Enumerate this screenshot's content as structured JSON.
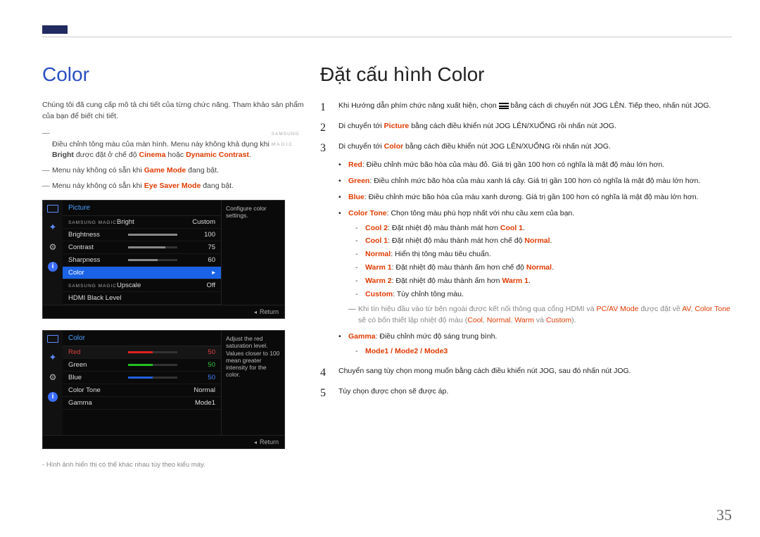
{
  "page_number": "35",
  "left": {
    "title": "Color",
    "intro": "Chúng tôi đã cung cấp mô tả chi tiết của từng chức năng. Tham khảo sản phẩm của bạn để biết chi tiết.",
    "bullets": [
      {
        "pre": "Điều chỉnh tông màu của màn hình. Menu này không khả dụng khi ",
        "magic_prefix": "SAMSUNG",
        "magic_word": "MAGIC",
        "magic_suffix": "Bright",
        "mid": " được đặt ở chế độ ",
        "kw1": "Cinema",
        "or": " hoặc ",
        "kw2": "Dynamic Contrast",
        "post": "."
      },
      {
        "pre": "Menu này không có sẵn khi ",
        "kw1": "Game Mode",
        "post": " đang bật."
      },
      {
        "pre": "Menu này không có sẵn khi ",
        "kw1": "Eye Saver Mode",
        "post": " đang bật."
      }
    ],
    "osd1": {
      "title": "Picture",
      "hint": "Configure color settings.",
      "rows": [
        {
          "label_prefix": "SAMSUNG MAGIC",
          "label": "Bright",
          "value": "Custom"
        },
        {
          "label": "Brightness",
          "bar": 100,
          "value": "100"
        },
        {
          "label": "Contrast",
          "bar": 75,
          "value": "75"
        },
        {
          "label": "Sharpness",
          "bar": 60,
          "value": "60"
        },
        {
          "label": "Color",
          "selected": true,
          "arrow": "▸"
        },
        {
          "label_prefix": "SAMSUNG MAGIC",
          "label": "Upscale",
          "value": "Off"
        },
        {
          "label": "HDMI Black Level"
        }
      ],
      "return": "Return"
    },
    "osd2": {
      "title": "Color",
      "hint": "Adjust the red saturation level. Values closer to 100 mean greater intensity for the color.",
      "rows": [
        {
          "label": "Red",
          "bar": 50,
          "barclass": "red",
          "value": "50",
          "valclass": "red-val",
          "selected": true
        },
        {
          "label": "Green",
          "bar": 50,
          "barclass": "green",
          "value": "50",
          "valclass": "green-val"
        },
        {
          "label": "Blue",
          "bar": 50,
          "barclass": "blue",
          "value": "50",
          "valclass": "blue-val"
        },
        {
          "label": "Color Tone",
          "value": "Normal"
        },
        {
          "label": "Gamma",
          "value": "Mode1"
        }
      ],
      "return": "Return"
    },
    "footnote": "Hình ảnh hiển thị có thể khác nhau tùy theo kiểu máy."
  },
  "right": {
    "title": "Đặt cấu hình Color",
    "step1": "Khi Hướng dẫn phím chức năng xuất hiện, chọn ",
    "step1b": " bằng cách di chuyển nút JOG LÊN. Tiếp theo, nhấn nút JOG.",
    "step2_pre": "Di chuyển tới ",
    "step2_kw": "Picture",
    "step2_post": " bằng cách điều khiển nút JOG LÊN/XUỐNG rồi nhấn nút JOG.",
    "step3_pre": "Di chuyển tới ",
    "step3_kw": "Color",
    "step3_post": " bằng cách điều khiển nút JOG LÊN/XUỐNG rồi nhấn nút JOG.",
    "colors": [
      {
        "kw": "Red",
        "text": ": Điều chỉnh mức bão hòa của màu đỏ. Giá trị gần 100 hơn có nghĩa là mật độ màu lớn hơn."
      },
      {
        "kw": "Green",
        "text": ": Điều chỉnh mức bão hòa của màu xanh lá cây. Giá trị gần 100 hơn có nghĩa là mật độ màu lớn hơn."
      },
      {
        "kw": "Blue",
        "text": ": Điều chỉnh mức bão hòa của màu xanh dương. Giá trị gần 100 hơn có nghĩa là mật độ màu lớn hơn."
      }
    ],
    "colortone_kw": "Color Tone",
    "colortone_text": ": Chọn tông màu phù hợp nhất với nhu cầu xem của bạn.",
    "tones": [
      {
        "kw": "Cool 2",
        "pre": ": Đặt nhiệt độ màu thành mát hơn ",
        "kw2": "Cool 1",
        "post": "."
      },
      {
        "kw": "Cool 1",
        "pre": ": Đặt nhiệt độ màu thành mát hơn chế độ ",
        "kw2": "Normal",
        "post": "."
      },
      {
        "kw": "Normal",
        "pre": ": Hiển thị tông màu tiêu chuẩn."
      },
      {
        "kw": "Warm 1",
        "pre": ": Đặt nhiệt độ màu thành ấm hơn chế độ ",
        "kw2": "Normal",
        "post": "."
      },
      {
        "kw": "Warm 2",
        "pre": ": Đặt nhiệt độ màu thành ấm hơn ",
        "kw2": "Warm 1",
        "post": "."
      },
      {
        "kw": "Custom",
        "pre": ": Tùy chỉnh tông màu."
      }
    ],
    "hdmi_note_pre": "Khi tín hiệu đầu vào từ bên ngoài được kết nối thông qua cổng HDMI và ",
    "hdmi_kw1": "PC/AV Mode",
    "hdmi_mid": " được đặt về ",
    "hdmi_kw2": "AV",
    "hdmi_post": ", ",
    "hdmi_line2_kw": "Color Tone",
    "hdmi_line2_mid": " sẽ có bốn thiết lập nhiệt độ màu (",
    "hdmi_c1": "Cool",
    "hdmi_c2": "Normal",
    "hdmi_c3": "Warm",
    "hdmi_and": " và ",
    "hdmi_c4": "Custom",
    "hdmi_close": ").",
    "gamma_kw": "Gamma",
    "gamma_text": ": Điều chỉnh mức độ sáng trung bình.",
    "gamma_modes": "Mode1 / Mode2 / Mode3",
    "step4": "Chuyển sang tùy chọn mong muốn bằng cách điều khiển nút JOG, sau đó nhấn nút JOG.",
    "step5": "Tùy chọn được chọn sẽ được áp."
  }
}
